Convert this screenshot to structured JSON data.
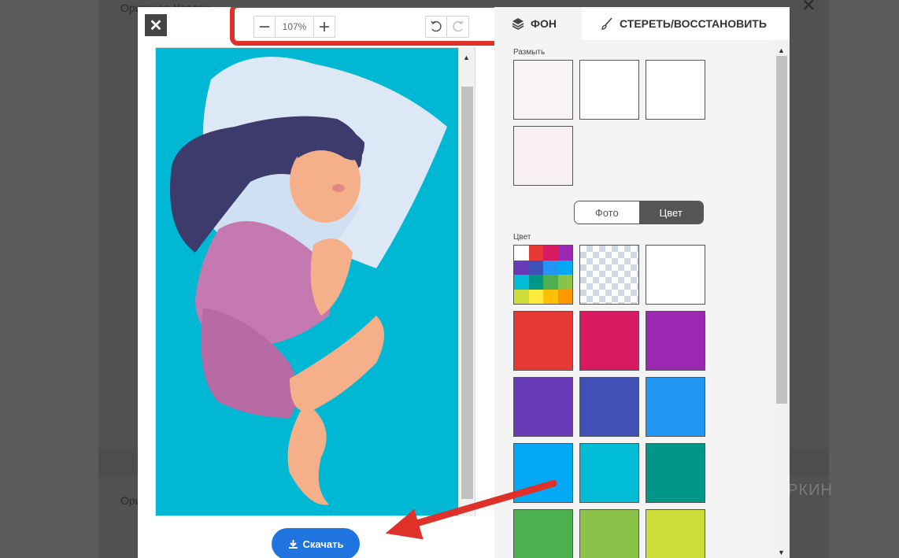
{
  "background_page": {
    "text1": "Оригинал   Удален...",
    "text2": "Ориг...",
    "watermark": "ПАРТНЕРКИН"
  },
  "toolbar": {
    "zoom_level": "107%",
    "zoom_out": "−",
    "zoom_in": "+"
  },
  "download": {
    "label": "Скачать"
  },
  "panel": {
    "tab_background": "ФОН",
    "tab_erase": "СТЕРЕТЬ/ВОССТАНОВИТЬ",
    "blur_label": "Размыть",
    "toggle_photo": "Фото",
    "toggle_color": "Цвет",
    "color_label": "Цвет"
  },
  "colors": {
    "accent": "#1f74e0",
    "highlight": "#e0302a",
    "image_bg": "#00b8d4",
    "swatches": [
      "#e53935",
      "#d81b60",
      "#9c27b0",
      "#673ab7",
      "#3f51b5",
      "#2196f3",
      "#03a9f4",
      "#00bcd4",
      "#009688",
      "#4caf50",
      "#8bc34a",
      "#cddc39"
    ]
  },
  "icons": {
    "close": "close-icon",
    "undo": "undo-icon",
    "redo": "redo-icon",
    "layers": "layers-icon",
    "brush": "brush-icon",
    "download": "download-icon"
  }
}
